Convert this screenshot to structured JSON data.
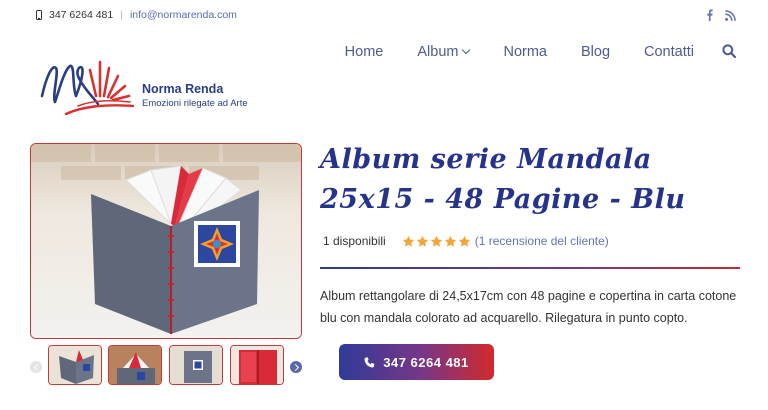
{
  "topbar": {
    "phone": "347 6264 481",
    "separator": "|",
    "email": "info@normarenda.com",
    "social_icons": [
      "facebook-icon",
      "rss-icon"
    ]
  },
  "nav": {
    "items": [
      {
        "label": "Home"
      },
      {
        "label": "Album",
        "has_dropdown": true
      },
      {
        "label": "Norma"
      },
      {
        "label": "Blog"
      },
      {
        "label": "Contatti"
      }
    ],
    "search_icon": "search-icon"
  },
  "brand": {
    "name": "Norma Renda",
    "tagline": "Emozioni rilegate ad Arte"
  },
  "product": {
    "title": "Album serie Mandala 25x15 - 48 Pagine - Blu",
    "stock": "1 disponibili",
    "rating": 5,
    "rating_max": 5,
    "reviews_link": "(1 recensione del cliente)",
    "description": "Album rettangolare di 24,5x17cm con 48 pagine e copertina in carta cotone blu con mandala colorato ad acquarello. Rilegatura in punto copto.",
    "call_button": "347 6264 481",
    "thumbnail_count": 4
  },
  "colors": {
    "brand_blue": "#26338a",
    "accent_red": "#c63a3a",
    "star_gold": "#f2a63a",
    "nav_text": "#4f5b8f"
  }
}
